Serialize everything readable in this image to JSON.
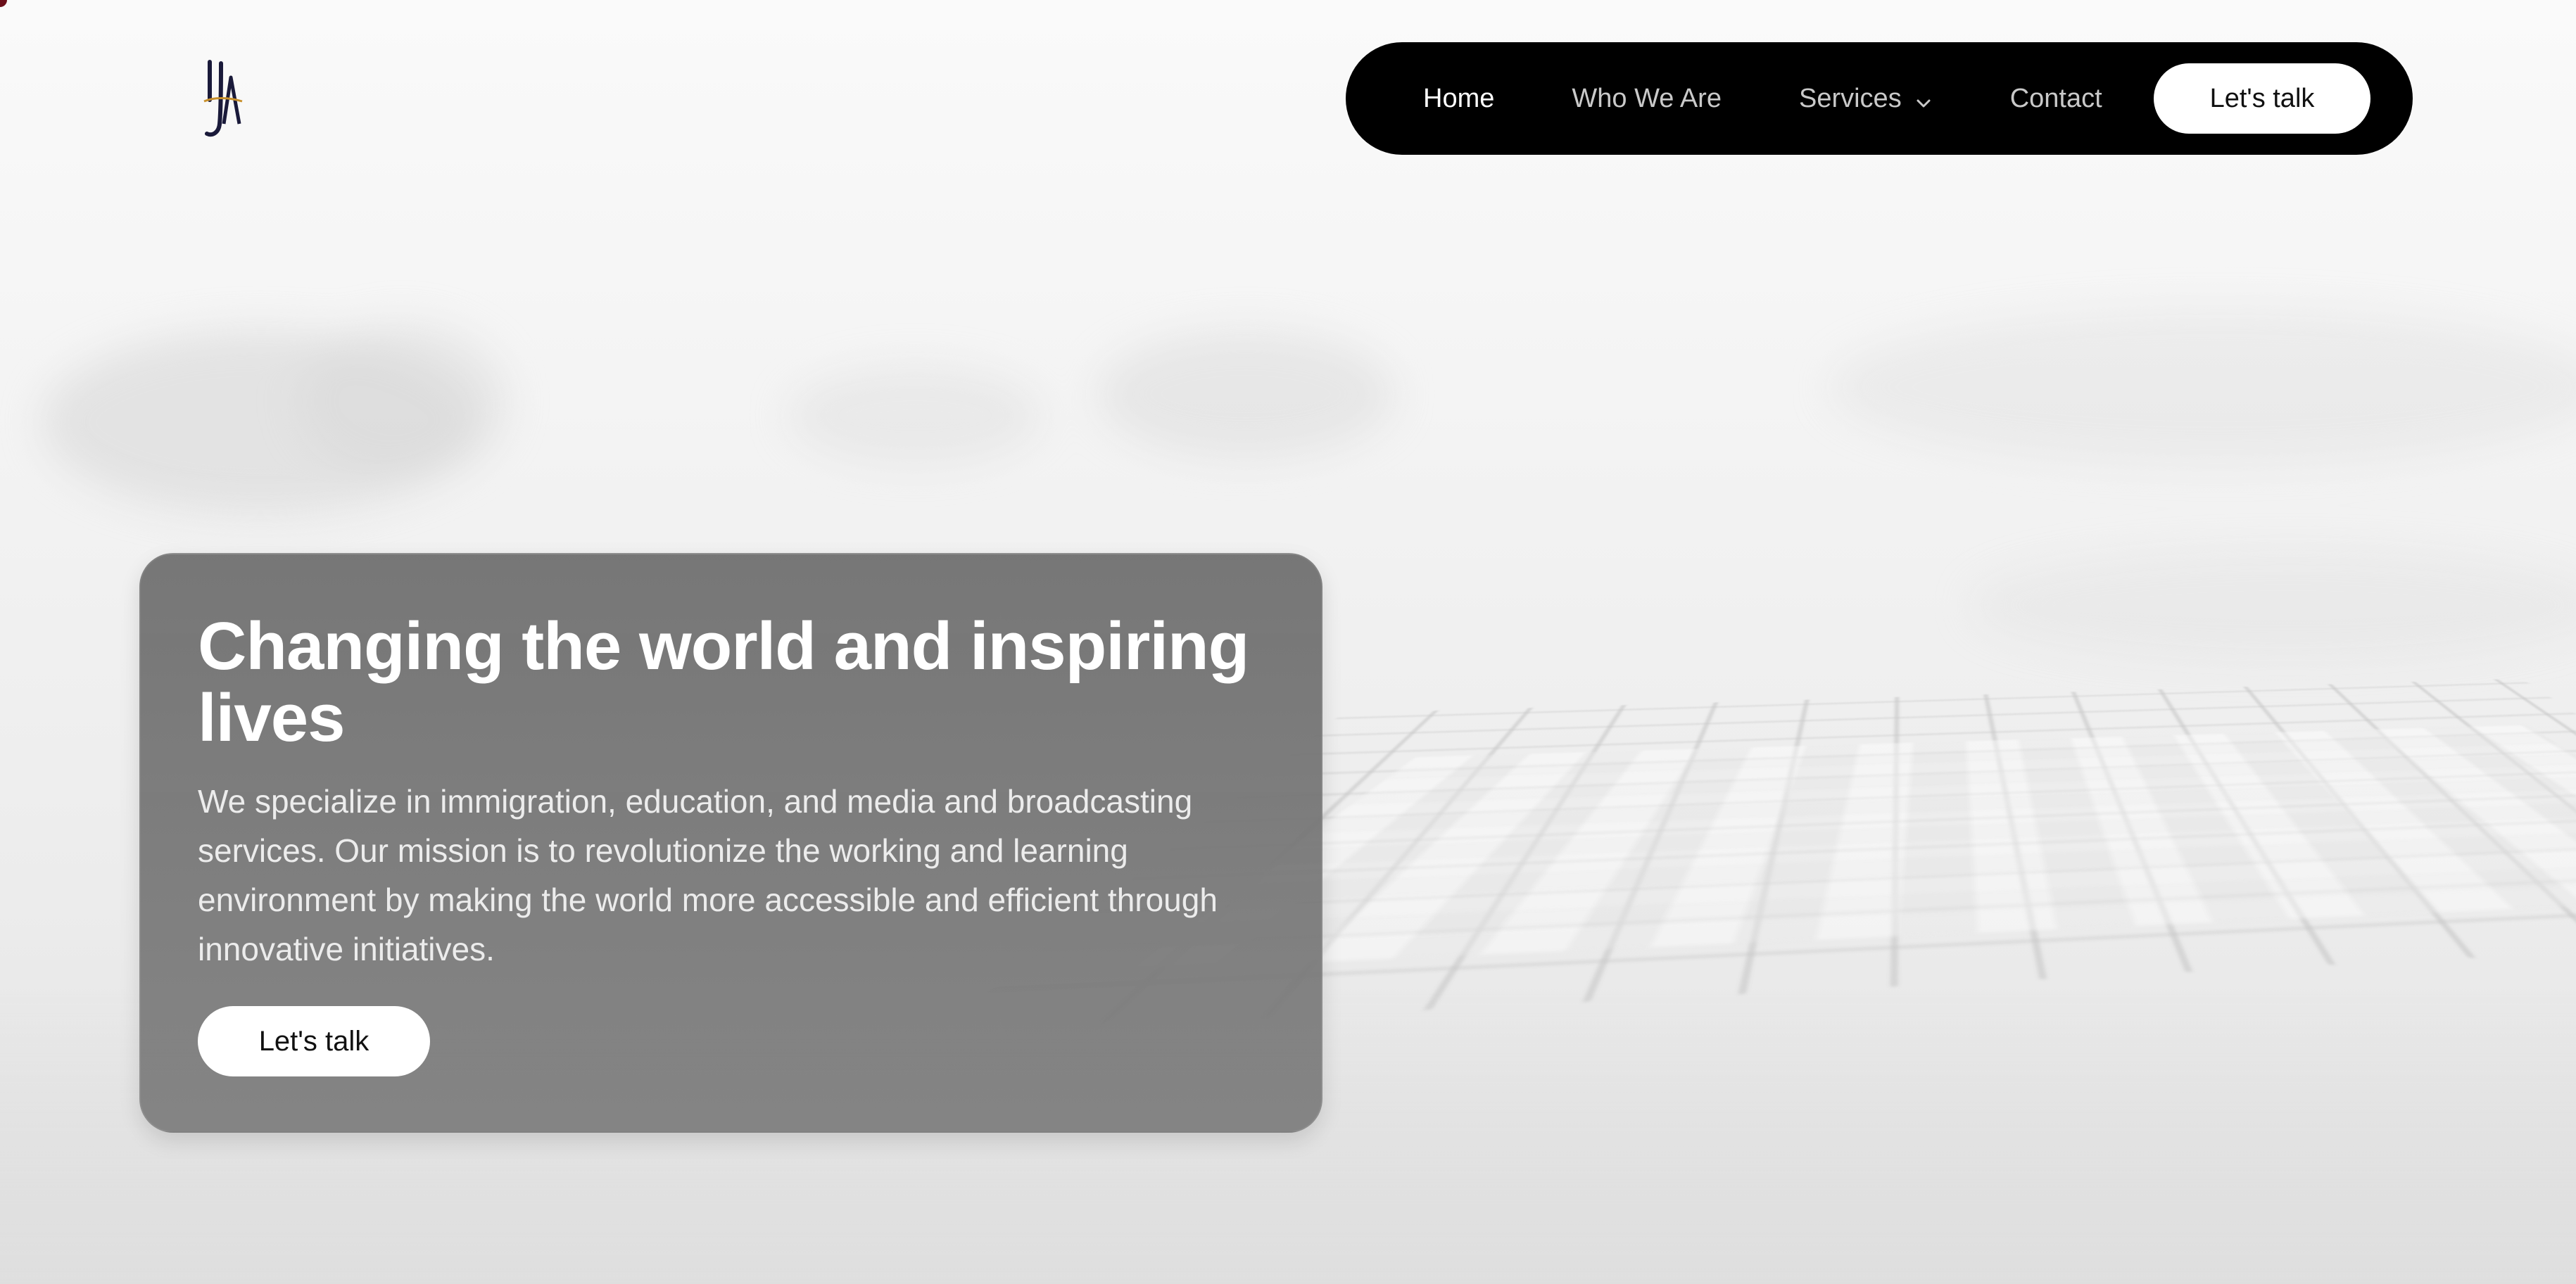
{
  "logo": {
    "text": "IJA",
    "icon": "ija-logo-icon"
  },
  "nav": {
    "items": [
      {
        "label": "Home",
        "active": true
      },
      {
        "label": "Who We Are",
        "active": false
      },
      {
        "label": "Services",
        "active": false,
        "icon": "chevron-down-icon"
      },
      {
        "label": "Contact",
        "active": false
      }
    ],
    "cta_label": "Let's talk"
  },
  "hero": {
    "title": "Changing the world and inspiring lives",
    "description": "We specialize in immigration, education, and media and broadcasting services. Our mission is to revolutionize the working and learning environment by making the world more accessible and efficient through innovative initiatives.",
    "cta_label": "Let's talk"
  },
  "colors": {
    "nav_background": "#000000",
    "nav_text": "#c9c9c9",
    "nav_text_active": "#ffffff",
    "card_background": "#777777",
    "button_background": "#ffffff",
    "logo_accent": "#c8902c",
    "logo_primary": "#1a1a3a"
  }
}
